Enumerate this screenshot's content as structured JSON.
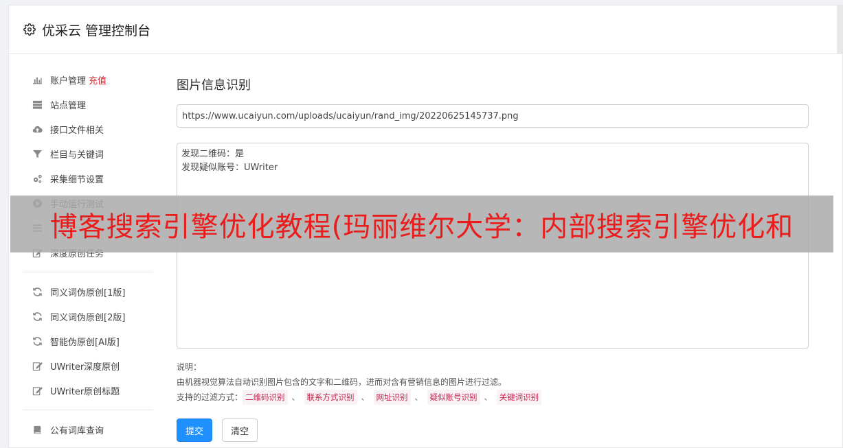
{
  "header": {
    "title": "优采云 管理控制台",
    "icon": "gear-icon"
  },
  "sidebar": {
    "groups": [
      [
        {
          "label": "账户管理",
          "badge": "充值",
          "icon": "bar-chart-icon"
        },
        {
          "label": "站点管理",
          "icon": "server-icon"
        },
        {
          "label": "接口文件相关",
          "icon": "cloud-upload-icon"
        },
        {
          "label": "栏目与关键词",
          "icon": "filter-icon"
        },
        {
          "label": "采集细节设置",
          "icon": "gears-icon"
        },
        {
          "label": "手动运行测试",
          "icon": "play-icon"
        },
        {
          "label": "",
          "icon": "list-icon"
        },
        {
          "label": "深度原创任务",
          "icon": "edit-icon"
        }
      ],
      [
        {
          "label": "同义词伪原创[1版]",
          "icon": "refresh-icon"
        },
        {
          "label": "同义词伪原创[2版]",
          "icon": "refresh-icon"
        },
        {
          "label": "智能伪原创[AI版]",
          "icon": "refresh-icon"
        },
        {
          "label": "UWriter深度原创",
          "icon": "edit-icon"
        },
        {
          "label": "UWriter原创标题",
          "icon": "edit-icon"
        }
      ],
      [
        {
          "label": "公有词库查询",
          "icon": "book-icon"
        }
      ]
    ]
  },
  "main": {
    "title": "图片信息识别",
    "url_value": "https://www.ucaiyun.com/uploads/ucaiyun/rand_img/20220625145737.png",
    "result_text": "发现二维码：是\n发现疑似账号：UWriter",
    "notes_label": "说明：",
    "notes_desc": "由机器视觉算法自动识别图片包含的文字和二维码，进而对含有营销信息的图片进行过滤。",
    "filter_label": "支持的过滤方式：",
    "filters": [
      "二维码识别",
      "联系方式识别",
      "网址识别",
      "疑似账号识别",
      "关键词识别"
    ],
    "filter_sep": "、",
    "submit_label": "提交",
    "clear_label": "清空"
  },
  "banner": {
    "text": "博客搜索引擎优化教程(玛丽维尔大学：内部搜索引擎优化和"
  },
  "colors": {
    "primary": "#1e90ff",
    "accent_red": "#d9232d",
    "tag_text": "#c7254e",
    "banner_text": "#ea1c1c"
  }
}
